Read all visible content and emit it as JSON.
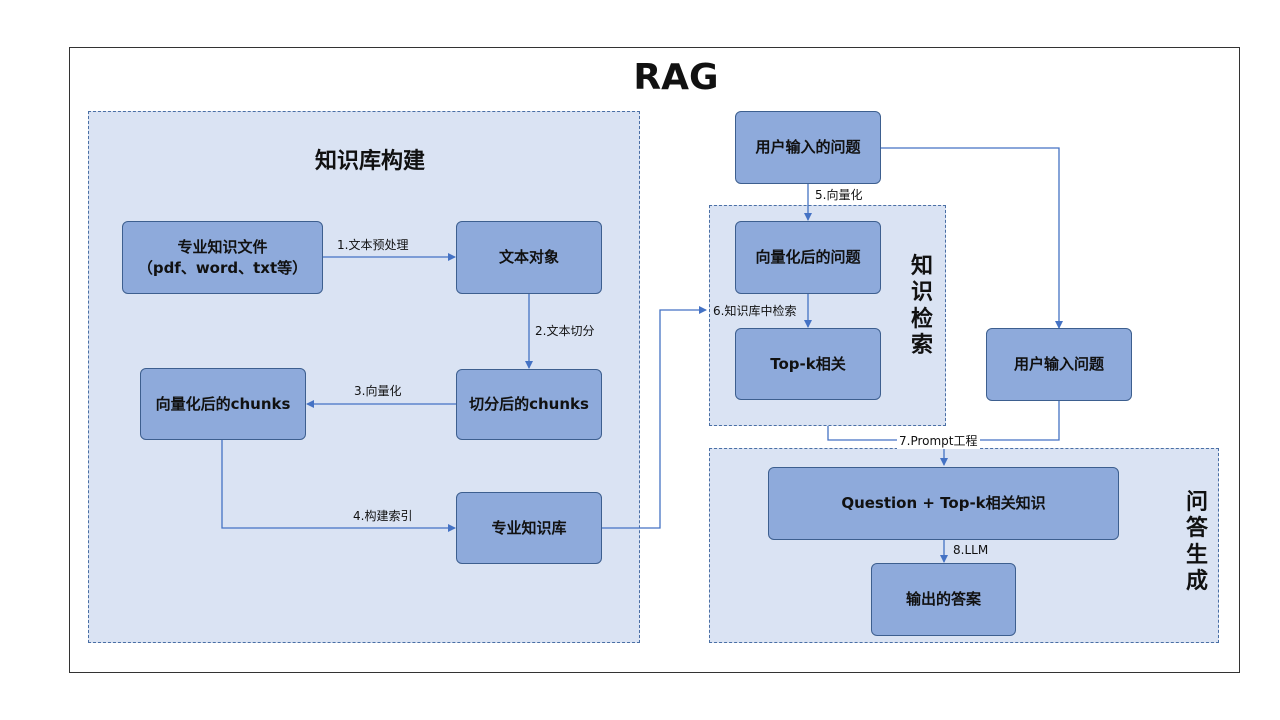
{
  "title": "RAG",
  "regions": {
    "kb": {
      "title": "知识库构建"
    },
    "retrieval": {
      "title": "知识检索"
    },
    "qa": {
      "title": "问答生成"
    }
  },
  "nodes": {
    "doc_files": "专业知识文件\n（pdf、word、txt等）",
    "text_object": "文本对象",
    "split_chunks": "切分后的chunks",
    "vec_chunks": "向量化后的chunks",
    "kb_store": "专业知识库",
    "user_question": "用户输入的问题",
    "vec_question": "向量化后的问题",
    "topk": "Top-k相关",
    "user_question2": "用户输入问题",
    "combined": "Question + Top-k相关知识",
    "answer": "输出的答案"
  },
  "edges": {
    "e1": "1.文本预处理",
    "e2": "2.文本切分",
    "e3": "3.向量化",
    "e4": "4.构建索引",
    "e5": "5.向量化",
    "e6": "6.知识库中检索",
    "e7": "7.Prompt工程",
    "e8": "8.LLM"
  },
  "colors": {
    "region_fill": "#dae3f3",
    "node_fill": "#8eaadb",
    "arrow": "#4472c4"
  }
}
